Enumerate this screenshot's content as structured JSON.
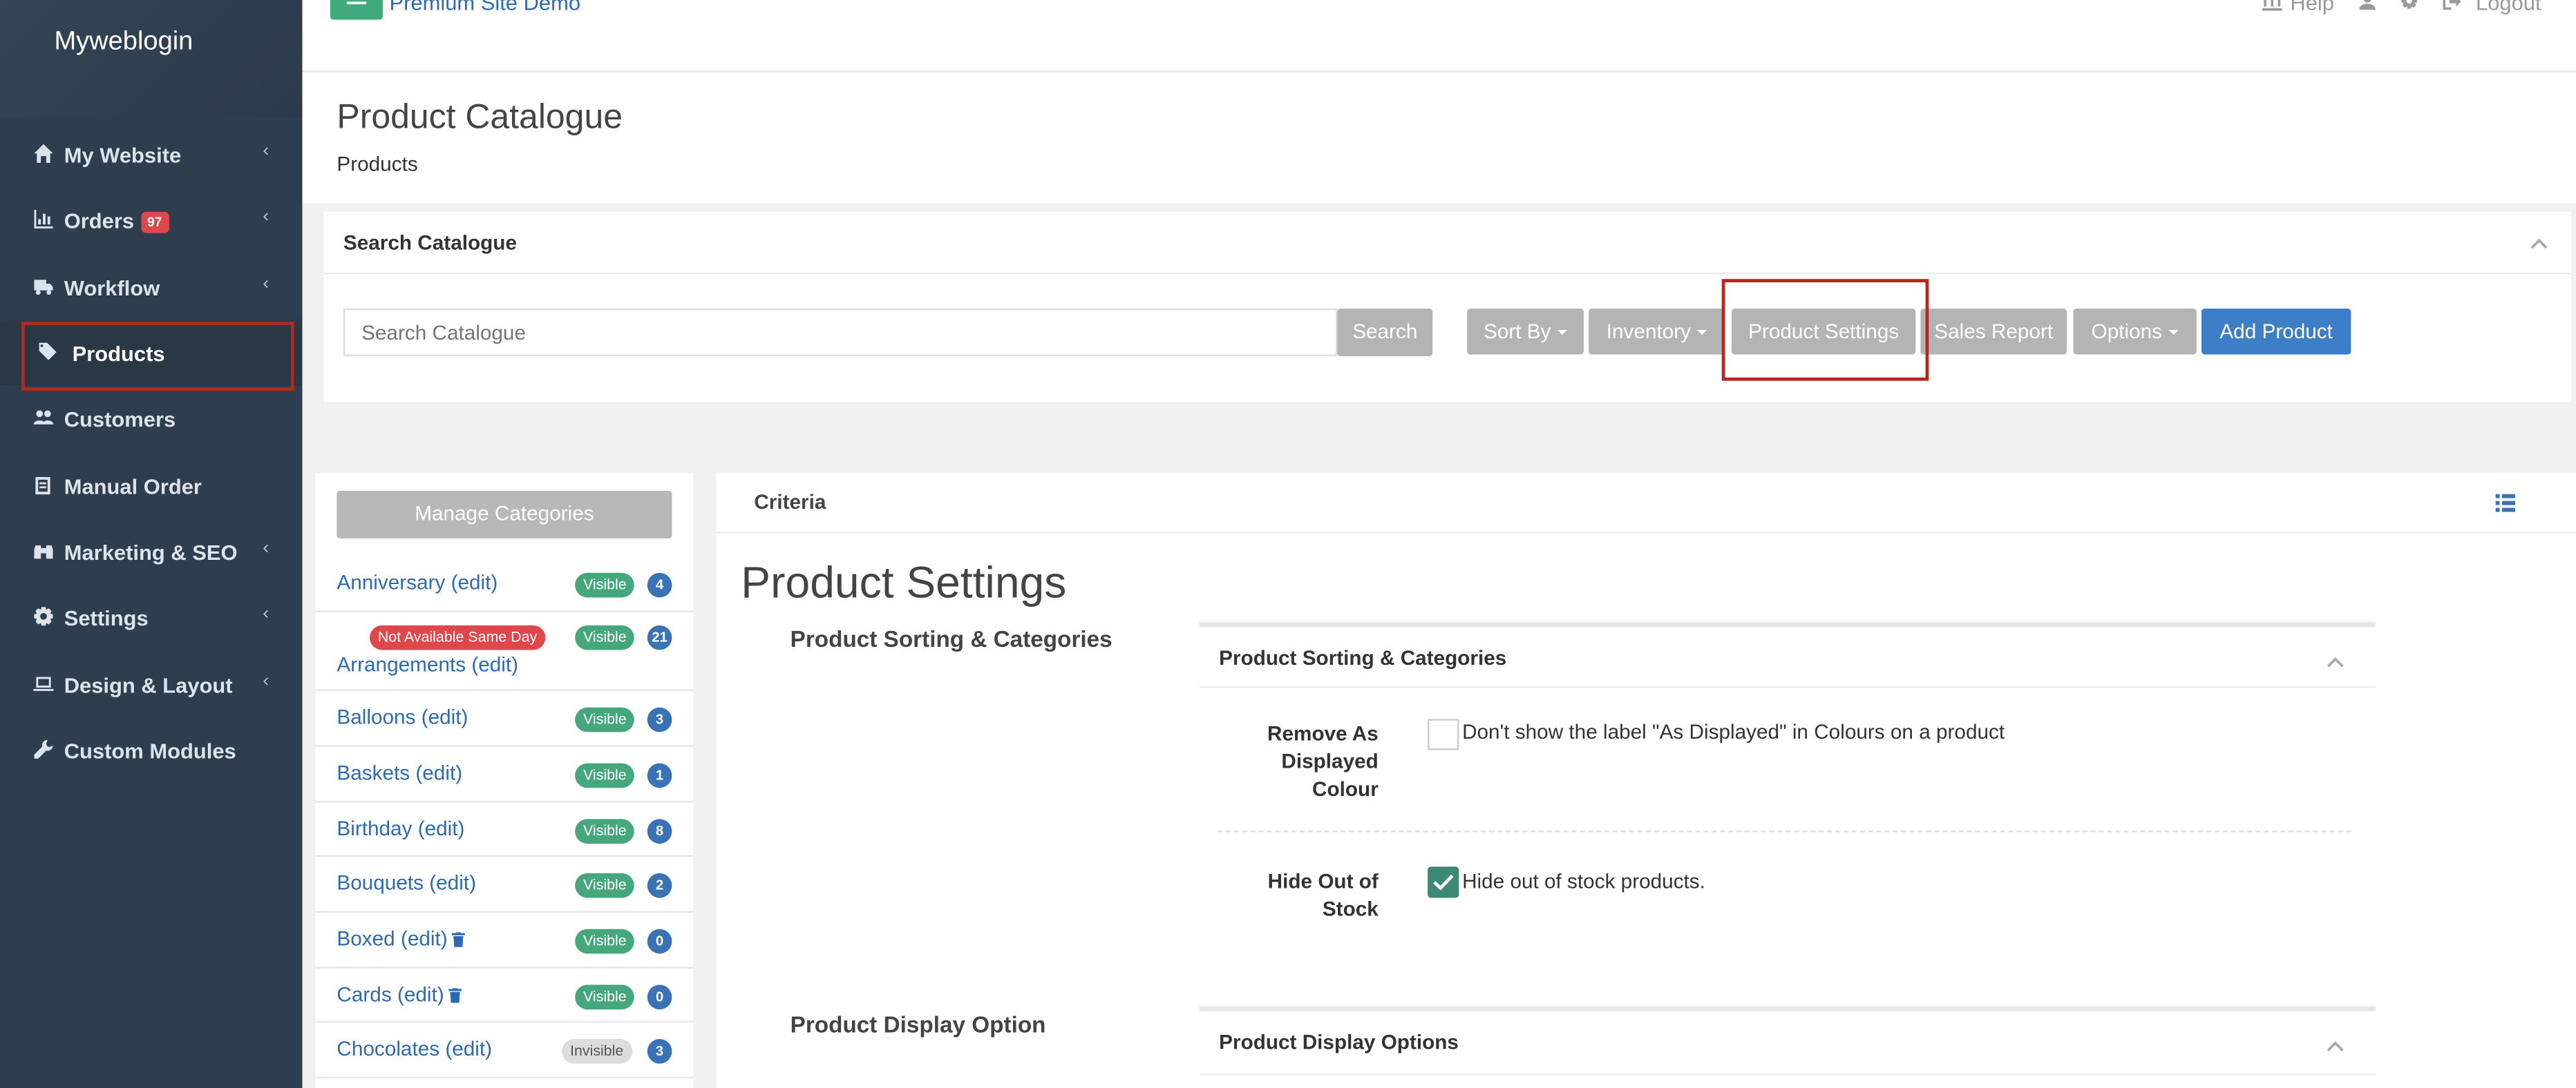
{
  "brand": "Myweblogin",
  "top": {
    "site_label": "Premium Site Demo",
    "help": "Help",
    "logout": "Logout"
  },
  "sidebar": {
    "items": [
      {
        "label": "My Website",
        "icon": "home-icon"
      },
      {
        "label": "Orders",
        "icon": "bar-chart-icon",
        "badge": "97"
      },
      {
        "label": "Workflow",
        "icon": "truck-icon"
      },
      {
        "label": "Products",
        "icon": "tags-icon"
      },
      {
        "label": "Customers",
        "icon": "users-icon"
      },
      {
        "label": "Manual Order",
        "icon": "book-icon"
      },
      {
        "label": "Marketing & SEO",
        "icon": "binoculars-icon"
      },
      {
        "label": "Settings",
        "icon": "gear-icon"
      },
      {
        "label": "Design & Layout",
        "icon": "laptop-icon"
      },
      {
        "label": "Custom Modules",
        "icon": "wrench-icon"
      }
    ]
  },
  "page": {
    "title": "Product Catalogue",
    "breadcrumb": "Products"
  },
  "search": {
    "header": "Search Catalogue",
    "placeholder": "Search Catalogue",
    "search_btn": "Search",
    "sort_by": "Sort By",
    "inventory": "Inventory",
    "product_settings": "Product Settings",
    "sales_report": "Sales Report",
    "options": "Options",
    "add_product": "Add Product"
  },
  "categories": {
    "manage_btn": "Manage Categories",
    "items": [
      {
        "name": "Anniversary (edit)",
        "status": "Visible",
        "count": "4"
      },
      {
        "name": "Arrangements (edit)",
        "status": "Visible",
        "count": "21",
        "extra": "Not Available Same Day"
      },
      {
        "name": "Balloons (edit)",
        "status": "Visible",
        "count": "3"
      },
      {
        "name": "Baskets (edit)",
        "status": "Visible",
        "count": "1"
      },
      {
        "name": "Birthday (edit)",
        "status": "Visible",
        "count": "8"
      },
      {
        "name": "Bouquets (edit)",
        "status": "Visible",
        "count": "2"
      },
      {
        "name": "Boxed (edit)",
        "status": "Visible",
        "count": "0",
        "trash": true
      },
      {
        "name": "Cards (edit)",
        "status": "Visible",
        "count": "0",
        "trash": true
      },
      {
        "name": "Chocolates (edit)",
        "status": "Invisible",
        "count": "3"
      }
    ]
  },
  "criteria": {
    "header": "Criteria",
    "title": "Product Settings",
    "section1": "Product Sorting & Categories",
    "panel1": "Product Sorting & Categories",
    "remove_label": "Remove As Displayed Colour",
    "remove_text": "Don't show the label \"As Displayed\" in Colours on a product",
    "remove_checked": false,
    "hide_label": "Hide Out of Stock",
    "hide_text": "Hide out of stock products.",
    "hide_checked": true,
    "section2": "Product Display Option",
    "panel2": "Product Display Options"
  },
  "colors": {
    "sidebar": "#2f3e4e",
    "accent_green": "#3eaa7b",
    "primary_blue": "#3c7fc7",
    "highlight_red": "#b22a1f"
  }
}
